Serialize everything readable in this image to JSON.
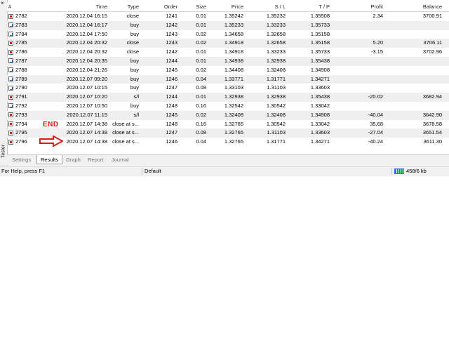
{
  "sidebar": {
    "close_glyph": "×",
    "label": "Tester"
  },
  "columns": {
    "hash": "#",
    "time": "Time",
    "type": "Type",
    "order": "Order",
    "size": "Size",
    "price": "Price",
    "sl": "S / L",
    "tp": "T / P",
    "profit": "Profit",
    "balance": "Balance"
  },
  "rows": [
    {
      "num": "2782",
      "time": "2020.12.04 16:15",
      "type": "close",
      "order": "1241",
      "size": "0.01",
      "price": "1.35242",
      "sl": "1.35232",
      "tp": "1.35508",
      "profit": "2.34",
      "balance": "3700.91",
      "icon": "close"
    },
    {
      "num": "2783",
      "time": "2020.12.04 16:17",
      "type": "buy",
      "order": "1242",
      "size": "0.01",
      "price": "1.35233",
      "sl": "1.33233",
      "tp": "1.35733",
      "profit": "",
      "balance": "",
      "icon": "buy"
    },
    {
      "num": "2784",
      "time": "2020.12.04 17:50",
      "type": "buy",
      "order": "1243",
      "size": "0.02",
      "price": "1.34658",
      "sl": "1.32658",
      "tp": "1.35158",
      "profit": "",
      "balance": "",
      "icon": "buy"
    },
    {
      "num": "2785",
      "time": "2020.12.04 20:32",
      "type": "close",
      "order": "1243",
      "size": "0.02",
      "price": "1.34918",
      "sl": "1.32658",
      "tp": "1.35158",
      "profit": "5.20",
      "balance": "3706.11",
      "icon": "close"
    },
    {
      "num": "2786",
      "time": "2020.12.04 20:32",
      "type": "close",
      "order": "1242",
      "size": "0.01",
      "price": "1.34918",
      "sl": "1.33233",
      "tp": "1.35733",
      "profit": "-3.15",
      "balance": "3702.96",
      "icon": "close"
    },
    {
      "num": "2787",
      "time": "2020.12.04 20:35",
      "type": "buy",
      "order": "1244",
      "size": "0.01",
      "price": "1.34938",
      "sl": "1.32938",
      "tp": "1.35438",
      "profit": "",
      "balance": "",
      "icon": "buy"
    },
    {
      "num": "2788",
      "time": "2020.12.04 21:26",
      "type": "buy",
      "order": "1245",
      "size": "0.02",
      "price": "1.34408",
      "sl": "1.32408",
      "tp": "1.34908",
      "profit": "",
      "balance": "",
      "icon": "buy"
    },
    {
      "num": "2789",
      "time": "2020.12.07 09:20",
      "type": "buy",
      "order": "1246",
      "size": "0.04",
      "price": "1.33771",
      "sl": "1.31771",
      "tp": "1.34271",
      "profit": "",
      "balance": "",
      "icon": "buy"
    },
    {
      "num": "2790",
      "time": "2020.12.07 10:15",
      "type": "buy",
      "order": "1247",
      "size": "0.08",
      "price": "1.33103",
      "sl": "1.31103",
      "tp": "1.33603",
      "profit": "",
      "balance": "",
      "icon": "buy"
    },
    {
      "num": "2791",
      "time": "2020.12.07 10:20",
      "type": "s/l",
      "order": "1244",
      "size": "0.01",
      "price": "1.32938",
      "sl": "1.32938",
      "tp": "1.35438",
      "profit": "-20.02",
      "balance": "3682.94",
      "icon": "sl"
    },
    {
      "num": "2792",
      "time": "2020.12.07 10:50",
      "type": "buy",
      "order": "1248",
      "size": "0.16",
      "price": "1.32542",
      "sl": "1.30542",
      "tp": "1.33042",
      "profit": "",
      "balance": "",
      "icon": "buy"
    },
    {
      "num": "2793",
      "time": "2020.12.07 11:15",
      "type": "s/l",
      "order": "1245",
      "size": "0.02",
      "price": "1.32408",
      "sl": "1.32408",
      "tp": "1.34908",
      "profit": "-40.04",
      "balance": "3642.90",
      "icon": "sl"
    },
    {
      "num": "2794",
      "time": "2020.12.07 14:38",
      "type": "close at s...",
      "order": "1248",
      "size": "0.16",
      "price": "1.32765",
      "sl": "1.30542",
      "tp": "1.33042",
      "profit": "35.68",
      "balance": "3678.58",
      "icon": "close"
    },
    {
      "num": "2795",
      "time": "2020.12.07 14:38",
      "type": "close at s...",
      "order": "1247",
      "size": "0.08",
      "price": "1.32765",
      "sl": "1.31103",
      "tp": "1.33603",
      "profit": "-27.04",
      "balance": "3651.54",
      "icon": "close"
    },
    {
      "num": "2796",
      "time": "2020.12.07 14:38",
      "type": "close at s...",
      "order": "1246",
      "size": "0.04",
      "price": "1.32765",
      "sl": "1.31771",
      "tp": "1.34271",
      "profit": "-40.24",
      "balance": "3611.30",
      "icon": "close"
    }
  ],
  "annotation": {
    "end_label": "END",
    "color": "#e01818"
  },
  "tabs": [
    "Settings",
    "Results",
    "Graph",
    "Report",
    "Journal"
  ],
  "active_tab": "Results",
  "statusbar": {
    "help": "For Help, press F1",
    "profile": "Default",
    "traffic": "458/6 kb"
  }
}
